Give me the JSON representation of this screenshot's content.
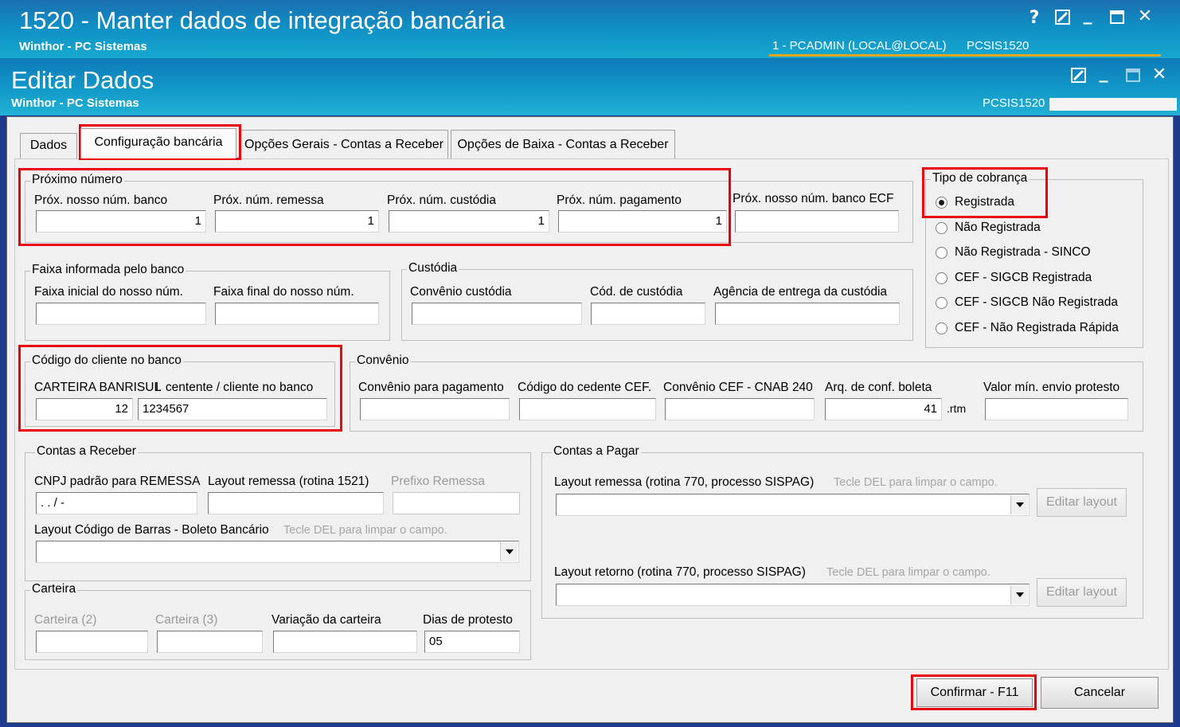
{
  "outer_window": {
    "title": "1520 - Manter dados de integração bancária",
    "subtitle": "Winthor - PC Sistemas",
    "user": "1 - PCADMIN (LOCAL@LOCAL)",
    "routine": "PCSIS1520",
    "buttons": {
      "help": "?",
      "minimize": "_",
      "close": "✕"
    }
  },
  "inner_window": {
    "title": "Editar Dados",
    "subtitle": "Winthor - PC Sistemas",
    "routine": "PCSIS1520",
    "buttons": {
      "minimize": "_",
      "close": "✕"
    }
  },
  "tabs": [
    {
      "label": "Dados"
    },
    {
      "label": "Configuração bancária"
    },
    {
      "label": "Opções Gerais - Contas a Receber"
    },
    {
      "label": "Opções de Baixa - Contas a Receber"
    }
  ],
  "proximo_numero": {
    "title": "Próximo número",
    "fields": [
      {
        "label": "Próx. nosso núm. banco",
        "value": "1"
      },
      {
        "label": "Próx. núm. remessa",
        "value": "1"
      },
      {
        "label": "Próx. núm. custódia",
        "value": "1"
      },
      {
        "label": "Próx. núm. pagamento",
        "value": "1"
      },
      {
        "label": "Próx. nosso núm. banco ECF",
        "value": ""
      }
    ]
  },
  "tipo_cobranca": {
    "title": "Tipo de cobrança",
    "options": [
      {
        "label": "Registrada",
        "selected": true
      },
      {
        "label": "Não Registrada",
        "selected": false
      },
      {
        "label": "Não Registrada - SINCO",
        "selected": false
      },
      {
        "label": "CEF - SIGCB Registrada",
        "selected": false
      },
      {
        "label": "CEF - SIGCB Não Registrada",
        "selected": false
      },
      {
        "label": "CEF - Não Registrada Rápida",
        "selected": false
      }
    ]
  },
  "faixa": {
    "title": "Faixa informada pelo banco",
    "inicial_label": "Faixa inicial do nosso núm.",
    "final_label": "Faixa final do nosso núm."
  },
  "custodia": {
    "title": "Custódia",
    "convenio_label": "Convênio custódia",
    "cod_label": "Cód. de custódia",
    "agencia_label": "Agência de entrega da custódia"
  },
  "codigo_cliente": {
    "title": "Código do cliente no banco",
    "carteira_label": "CARTEIRA BANRISUL",
    "carteira_value": "12",
    "ident_label": "I. centente / cliente no banco",
    "ident_value": "1234567"
  },
  "convenio": {
    "title": "Convênio",
    "pagamento_label": "Convênio para pagamento",
    "cedente_label": "Código do cedente CEF.",
    "cnab_label": "Convênio CEF - CNAB 240",
    "arq_label": "Arq. de conf. boleta",
    "arq_value": "41",
    "arq_ext": ".rtm",
    "valor_label": "Valor mín. envio protesto"
  },
  "contas_receber": {
    "title": "Contas a Receber",
    "cnpj_label": "CNPJ padrão para REMESSA",
    "cnpj_value": " .  .  /  -",
    "layout_label": "Layout remessa (rotina 1521)",
    "prefixo_label": "Prefixo Remessa",
    "barras_label": "Layout Código de Barras - Boleto Bancário",
    "barras_hint": "Tecle DEL para limpar o campo."
  },
  "carteira": {
    "title": "Carteira",
    "c2_label": "Carteira (2)",
    "c3_label": "Carteira (3)",
    "variacao_label": "Variação da carteira",
    "dias_label": "Dias de protesto",
    "dias_value": "05"
  },
  "contas_pagar": {
    "title": "Contas a Pagar",
    "remessa_label": "Layout remessa (rotina 770, processo SISPAG)",
    "remessa_hint": "Tecle DEL para limpar o campo.",
    "retorno_label": "Layout retorno (rotina 770, processo SISPAG)",
    "retorno_hint": "Tecle DEL para limpar o campo.",
    "editar_label": "Editar layout"
  },
  "footer": {
    "confirm_label": "Confirmar - F11",
    "cancel_label": "Cancelar"
  },
  "colors": {
    "highlight": "#e8000b",
    "titlebar": "#1199c9",
    "accent_line": "#e8a51a"
  }
}
